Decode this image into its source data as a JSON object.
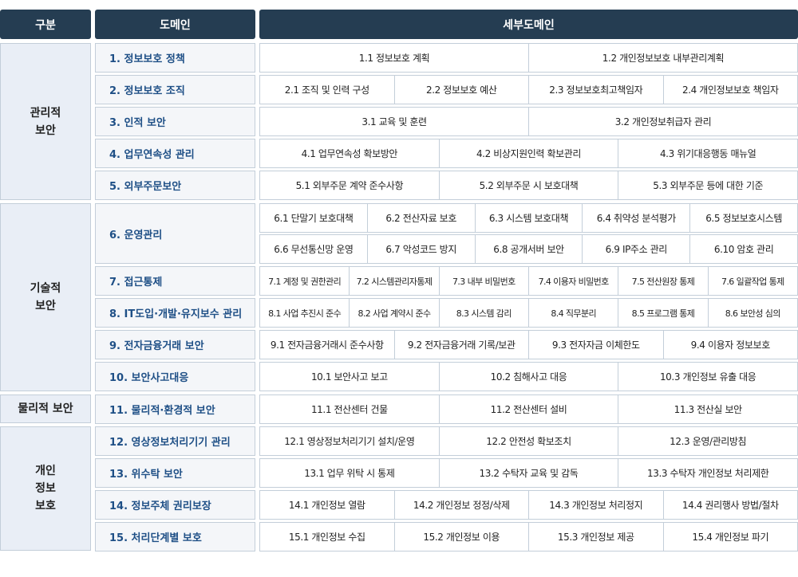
{
  "header": {
    "category": "구분",
    "domain": "도메인",
    "subdomain": "세부도메인"
  },
  "categories": [
    {
      "label": "관리적\n보안"
    },
    {
      "label": "기술적\n보안"
    },
    {
      "label": "물리적 보안"
    },
    {
      "label": "개인\n정보\n보호"
    }
  ],
  "rows": [
    {
      "domain": "1. 정보보호 정책",
      "subs": [
        "1.1 정보보호 계획",
        "1.2 개인정보보호 내부관리계획"
      ]
    },
    {
      "domain": "2. 정보보호 조직",
      "subs": [
        "2.1 조직 및 인력 구성",
        "2.2 정보보호 예산",
        "2.3 정보보호최고책임자",
        "2.4 개인정보보호 책임자"
      ]
    },
    {
      "domain": "3. 인적 보안",
      "subs": [
        "3.1 교육 및 훈련",
        "3.2 개인정보취급자 관리"
      ]
    },
    {
      "domain": "4. 업무연속성 관리",
      "subs": [
        "4.1 업무연속성 확보방안",
        "4.2 비상지원인력 확보관리",
        "4.3 위기대응행동 매뉴얼"
      ]
    },
    {
      "domain": "5. 외부주문보안",
      "subs": [
        "5.1 외부주문 계약 준수사항",
        "5.2 외부주문 시 보호대책",
        "5.3 외부주문 등에 대한 기준"
      ]
    },
    {
      "domain": "6. 운영관리",
      "subs": [
        "6.1 단말기 보호대책",
        "6.2 전산자료 보호",
        "6.3 시스템 보호대책",
        "6.4 취약성 분석평가",
        "6.5 정보보호시스템"
      ],
      "subs2": [
        "6.6 무선통신망 운영",
        "6.7 악성코드 방지",
        "6.8 공개서버 보안",
        "6.9 IP주소 관리",
        "6.10 암호 관리"
      ]
    },
    {
      "domain": "7. 접근통제",
      "subs": [
        "7.1 계정 및 권한관리",
        "7.2 시스템관리자통제",
        "7.3 내부 비밀번호",
        "7.4 이용자 비밀번호",
        "7.5 전산원장 통제",
        "7.6 일괄작업 통제"
      ]
    },
    {
      "domain": "8. IT도입·개발·유지보수 관리",
      "subs": [
        "8.1 사업 추진시 준수",
        "8.2 사업 계약시 준수",
        "8.3 시스템 감리",
        "8.4 직무분리",
        "8.5 프로그램 통제",
        "8.6 보안성 심의"
      ]
    },
    {
      "domain": "9. 전자금융거래 보안",
      "subs": [
        "9.1 전자금융거래시 준수사항",
        "9.2 전자금융거래 기록/보관",
        "9.3 전자자금 이체한도",
        "9.4 이용자 정보보호"
      ]
    },
    {
      "domain": "10. 보안사고대응",
      "subs": [
        "10.1 보안사고 보고",
        "10.2 침해사고 대응",
        "10.3 개인정보 유출 대응"
      ]
    },
    {
      "domain": "11. 물리적·환경적 보안",
      "subs": [
        "11.1 전산센터 건물",
        "11.2 전산센터 설비",
        "11.3 전산실 보안"
      ]
    },
    {
      "domain": "12. 영상정보처리기기 관리",
      "subs": [
        "12.1 영상정보처리기기 설치/운영",
        "12.2 안전성 확보조치",
        "12.3 운영/관리방침"
      ]
    },
    {
      "domain": "13. 위수탁 보안",
      "subs": [
        "13.1 업무 위탁 시 통제",
        "13.2 수탁자 교육 및 감독",
        "13.3 수탁자 개인정보 처리제한"
      ]
    },
    {
      "domain": "14. 정보주체 권리보장",
      "subs": [
        "14.1 개인정보 열람",
        "14.2 개인정보 정정/삭제",
        "14.3 개인정보 처리정지",
        "14.4 권리행사 방법/절차"
      ]
    },
    {
      "domain": "15. 처리단계별 보호",
      "subs": [
        "15.1 개인정보 수집",
        "15.2 개인정보 이용",
        "15.3 개인정보 제공",
        "15.4 개인정보 파기"
      ]
    }
  ]
}
